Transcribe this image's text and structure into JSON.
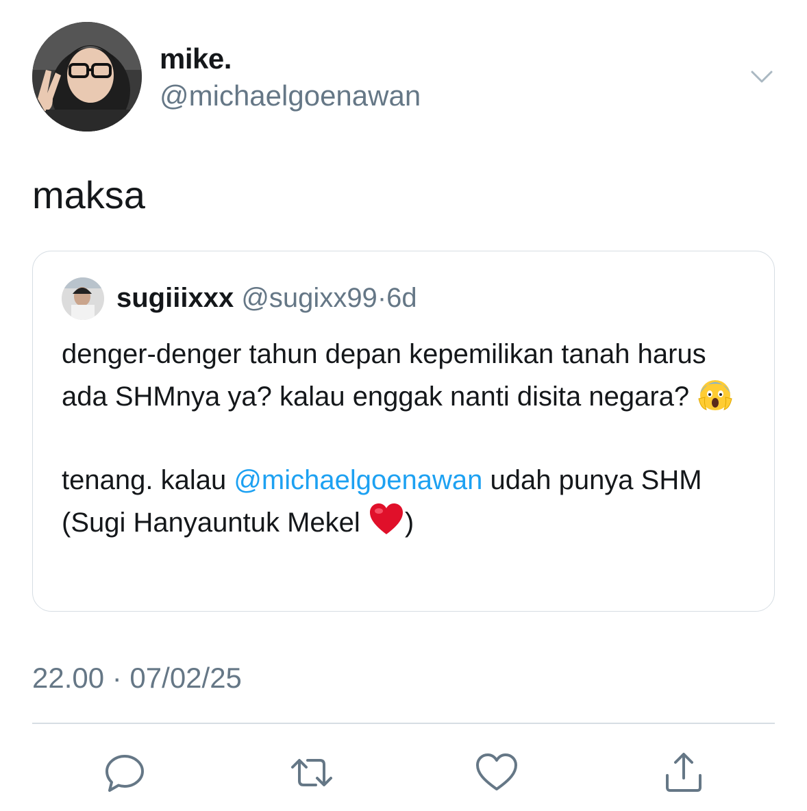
{
  "author": {
    "display_name": "mike.",
    "handle": "@michaelgoenawan",
    "avatar_icon": "profile-photo"
  },
  "tweet": {
    "text": "maksa",
    "timestamp": "22.00 · 07/02/25"
  },
  "quoted": {
    "display_name": "sugiiixxx",
    "handle": "@sugixx99",
    "separator": "·",
    "time": "6d",
    "line1": "denger-denger tahun depan kepemilikan tanah harus ada SHMnya ya? kalau enggak nanti disita negara?",
    "line2_before": "tenang. kalau ",
    "mention": "@michaelgoenawan",
    "line2_after": " udah punya SHM (Sugi Hanyauntuk Mekel ",
    "line2_end": ")",
    "emoji1": "face-screaming-in-fear",
    "emoji2": "red-heart"
  },
  "actions": {
    "reply_icon": "reply-icon",
    "retweet_icon": "retweet-icon",
    "like_icon": "heart-icon",
    "share_icon": "share-icon"
  },
  "colors": {
    "text": "#14171a",
    "muted": "#657786",
    "link": "#1da1f2",
    "border": "#d6dde3"
  }
}
